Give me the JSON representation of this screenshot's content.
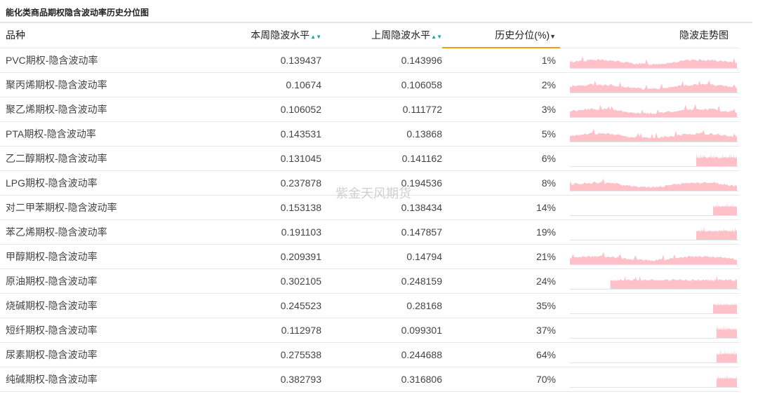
{
  "title": "能化类商品期权隐含波动率历史分位图",
  "watermark": "紫金天风期货",
  "colors": {
    "spark": "#ffc0c8",
    "accent": "#f39c12",
    "sort": "#1aa3a3"
  },
  "headers": {
    "name": "品种",
    "this_week": "本周隐波水平",
    "last_week": "上周隐波水平",
    "percentile": "历史分位(%)",
    "trend": "隐波走势图"
  },
  "rows": [
    {
      "name": "PVC期权-隐含波动率",
      "this_week": "0.139437",
      "last_week": "0.143996",
      "percentile": "1%"
    },
    {
      "name": "聚丙烯期权-隐含波动率",
      "this_week": "0.10674",
      "last_week": "0.106058",
      "percentile": "2%"
    },
    {
      "name": "聚乙烯期权-隐含波动率",
      "this_week": "0.106052",
      "last_week": "0.111772",
      "percentile": "3%"
    },
    {
      "name": "PTA期权-隐含波动率",
      "this_week": "0.143531",
      "last_week": "0.13868",
      "percentile": "5%"
    },
    {
      "name": "乙二醇期权-隐含波动率",
      "this_week": "0.131045",
      "last_week": "0.141162",
      "percentile": "6%"
    },
    {
      "name": "LPG期权-隐含波动率",
      "this_week": "0.237878",
      "last_week": "0.194536",
      "percentile": "8%"
    },
    {
      "name": "对二甲苯期权-隐含波动率",
      "this_week": "0.153138",
      "last_week": "0.138434",
      "percentile": "14%"
    },
    {
      "name": "苯乙烯期权-隐含波动率",
      "this_week": "0.191103",
      "last_week": "0.147857",
      "percentile": "19%"
    },
    {
      "name": "甲醇期权-隐含波动率",
      "this_week": "0.209391",
      "last_week": "0.14794",
      "percentile": "21%"
    },
    {
      "name": "原油期权-隐含波动率",
      "this_week": "0.302105",
      "last_week": "0.248159",
      "percentile": "24%"
    },
    {
      "name": "烧碱期权-隐含波动率",
      "this_week": "0.245523",
      "last_week": "0.28168",
      "percentile": "35%"
    },
    {
      "name": "短纤期权-隐含波动率",
      "this_week": "0.112978",
      "last_week": "0.099301",
      "percentile": "37%"
    },
    {
      "name": "尿素期权-隐含波动率",
      "this_week": "0.275538",
      "last_week": "0.244688",
      "percentile": "64%"
    },
    {
      "name": "纯碱期权-隐含波动率",
      "this_week": "0.382793",
      "last_week": "0.316806",
      "percentile": "70%"
    }
  ]
}
